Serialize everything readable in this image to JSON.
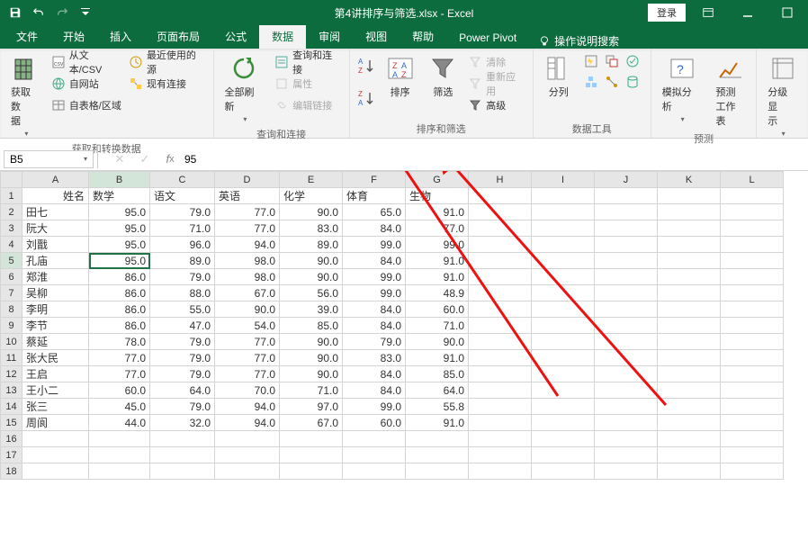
{
  "title": {
    "filename": "第4讲排序与筛选.xlsx",
    "app": "Excel",
    "sep": " - ",
    "login": "登录"
  },
  "tabs": [
    "文件",
    "开始",
    "插入",
    "页面布局",
    "公式",
    "数据",
    "审阅",
    "视图",
    "帮助",
    "Power Pivot"
  ],
  "active_tab": 5,
  "tell_me": "操作说明搜索",
  "groups": {
    "get": {
      "big": "获取数\n据",
      "items": [
        "从文本/CSV",
        "自网站",
        "自表格/区域",
        "最近使用的源",
        "现有连接"
      ],
      "label": "获取和转换数据"
    },
    "conn": {
      "big": "全部刷新",
      "items": [
        "查询和连接",
        "属性",
        "编辑链接"
      ],
      "label": "查询和连接"
    },
    "sort": {
      "big": "排序",
      "filter_big": "筛选",
      "items": [
        "清除",
        "重新应用",
        "高级"
      ],
      "label": "排序和筛选"
    },
    "tools": {
      "big": "分列",
      "label": "数据工具"
    },
    "forecast": {
      "big1": "模拟分析",
      "big2": "预测\n工作表",
      "label": "预测"
    },
    "group_g": {
      "big": "分级显\n示",
      "label": ""
    }
  },
  "namebox": "B5",
  "formula": "95",
  "columns": [
    "A",
    "B",
    "C",
    "D",
    "E",
    "F",
    "G",
    "H",
    "I",
    "J",
    "K",
    "L"
  ],
  "headers": [
    "姓名",
    "数学",
    "语文",
    "英语",
    "化学",
    "体育",
    "生物"
  ],
  "rows": [
    {
      "n": "田七",
      "v": [
        "95.0",
        "79.0",
        "77.0",
        "90.0",
        "65.0",
        "91.0"
      ]
    },
    {
      "n": "阮大",
      "v": [
        "95.0",
        "71.0",
        "77.0",
        "83.0",
        "84.0",
        "77.0"
      ]
    },
    {
      "n": "刘戬",
      "v": [
        "95.0",
        "96.0",
        "94.0",
        "89.0",
        "99.0",
        "99.0"
      ]
    },
    {
      "n": "孔庙",
      "v": [
        "95.0",
        "89.0",
        "98.0",
        "90.0",
        "84.0",
        "91.0"
      ]
    },
    {
      "n": "郑淮",
      "v": [
        "86.0",
        "79.0",
        "98.0",
        "90.0",
        "99.0",
        "91.0"
      ]
    },
    {
      "n": "吴柳",
      "v": [
        "86.0",
        "88.0",
        "67.0",
        "56.0",
        "99.0",
        "48.9"
      ]
    },
    {
      "n": "李明",
      "v": [
        "86.0",
        "55.0",
        "90.0",
        "39.0",
        "84.0",
        "60.0"
      ]
    },
    {
      "n": "李节",
      "v": [
        "86.0",
        "47.0",
        "54.0",
        "85.0",
        "84.0",
        "71.0"
      ]
    },
    {
      "n": "蔡延",
      "v": [
        "78.0",
        "79.0",
        "77.0",
        "90.0",
        "79.0",
        "90.0"
      ]
    },
    {
      "n": "张大民",
      "v": [
        "77.0",
        "79.0",
        "77.0",
        "90.0",
        "83.0",
        "91.0"
      ]
    },
    {
      "n": "王启",
      "v": [
        "77.0",
        "79.0",
        "77.0",
        "90.0",
        "84.0",
        "85.0"
      ]
    },
    {
      "n": "王小二",
      "v": [
        "60.0",
        "64.0",
        "70.0",
        "71.0",
        "84.0",
        "64.0"
      ]
    },
    {
      "n": "张三",
      "v": [
        "45.0",
        "79.0",
        "94.0",
        "97.0",
        "99.0",
        "55.8"
      ]
    },
    {
      "n": "周阆",
      "v": [
        "44.0",
        "32.0",
        "94.0",
        "67.0",
        "60.0",
        "91.0"
      ]
    }
  ],
  "selected": {
    "ref": "B5",
    "row": 5,
    "col": "B"
  },
  "chart_data": {
    "type": "table",
    "title": "第4讲排序与筛选",
    "columns": [
      "姓名",
      "数学",
      "语文",
      "英语",
      "化学",
      "体育",
      "生物"
    ],
    "records": [
      [
        "田七",
        95.0,
        79.0,
        77.0,
        90.0,
        65.0,
        91.0
      ],
      [
        "阮大",
        95.0,
        71.0,
        77.0,
        83.0,
        84.0,
        77.0
      ],
      [
        "刘戬",
        95.0,
        96.0,
        94.0,
        89.0,
        99.0,
        99.0
      ],
      [
        "孔庙",
        95.0,
        89.0,
        98.0,
        90.0,
        84.0,
        91.0
      ],
      [
        "郑淮",
        86.0,
        79.0,
        98.0,
        90.0,
        99.0,
        91.0
      ],
      [
        "吴柳",
        86.0,
        88.0,
        67.0,
        56.0,
        99.0,
        48.9
      ],
      [
        "李明",
        86.0,
        55.0,
        90.0,
        39.0,
        84.0,
        60.0
      ],
      [
        "李节",
        86.0,
        47.0,
        54.0,
        85.0,
        84.0,
        71.0
      ],
      [
        "蔡延",
        78.0,
        79.0,
        77.0,
        90.0,
        79.0,
        90.0
      ],
      [
        "张大民",
        77.0,
        79.0,
        77.0,
        90.0,
        83.0,
        91.0
      ],
      [
        "王启",
        77.0,
        79.0,
        77.0,
        90.0,
        84.0,
        85.0
      ],
      [
        "王小二",
        60.0,
        64.0,
        70.0,
        71.0,
        84.0,
        64.0
      ],
      [
        "张三",
        45.0,
        79.0,
        94.0,
        97.0,
        99.0,
        55.8
      ],
      [
        "周阆",
        44.0,
        32.0,
        94.0,
        67.0,
        60.0,
        91.0
      ]
    ]
  }
}
